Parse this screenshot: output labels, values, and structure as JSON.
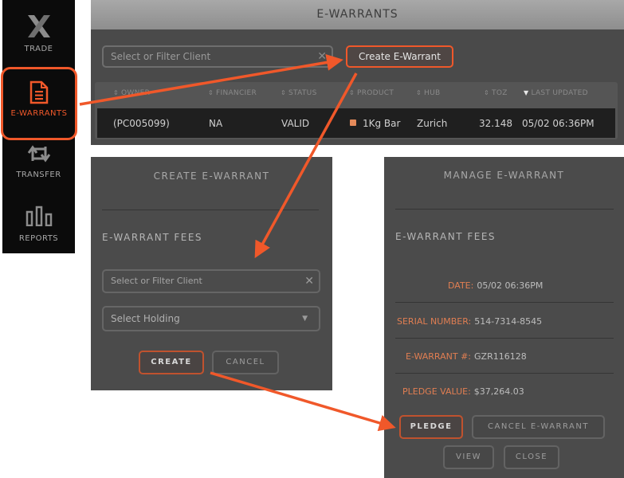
{
  "sidebar": {
    "items": [
      {
        "label": "TRADE",
        "icon": "x-logo-icon"
      },
      {
        "label": "E-WARRANTS",
        "icon": "document-icon",
        "active": true
      },
      {
        "label": "TRANSFER",
        "icon": "transfer-icon"
      },
      {
        "label": "REPORTS",
        "icon": "bar-chart-icon"
      }
    ]
  },
  "main": {
    "title": "E-WARRANTS",
    "filter_placeholder": "Select or Filter Client",
    "create_button": "Create E-Warrant",
    "table": {
      "columns": [
        "OWNER",
        "FINANCIER",
        "STATUS",
        "PRODUCT",
        "HUB",
        "TOZ",
        "LAST UPDATED"
      ],
      "sorted_column": "LAST UPDATED",
      "rows": [
        {
          "owner": "(PC005099)",
          "financier": "NA",
          "status": "VALID",
          "product": "1Kg Bar",
          "product_color": "#e58a5a",
          "hub": "Zurich",
          "toz": "32.148",
          "last_updated": "05/02 06:36PM"
        }
      ]
    }
  },
  "create_modal": {
    "title": "CREATE E-WARRANT",
    "section": "E-WARRANT FEES",
    "client_placeholder": "Select or Filter Client",
    "holding_placeholder": "Select Holding",
    "create_label": "CREATE",
    "cancel_label": "CANCEL"
  },
  "manage_modal": {
    "title": "MANAGE E-WARRANT",
    "section": "E-WARRANT FEES",
    "fields": [
      {
        "label": "DATE:",
        "value": "05/02 06:36PM"
      },
      {
        "label": "SERIAL NUMBER:",
        "value": "514-7314-8545"
      },
      {
        "label": "E-WARRANT #:",
        "value": "GZR116128"
      },
      {
        "label": "PLEDGE VALUE:",
        "value": "$37,264.03"
      }
    ],
    "buttons": {
      "pledge": "PLEDGE",
      "cancel_ewarrant": "CANCEL E-WARRANT",
      "view": "VIEW",
      "close": "CLOSE"
    }
  },
  "colors": {
    "accent": "#f0582a",
    "panel": "#4a4a4a",
    "sidebar": "#0b0b0b",
    "label_orange": "#e07e52"
  }
}
